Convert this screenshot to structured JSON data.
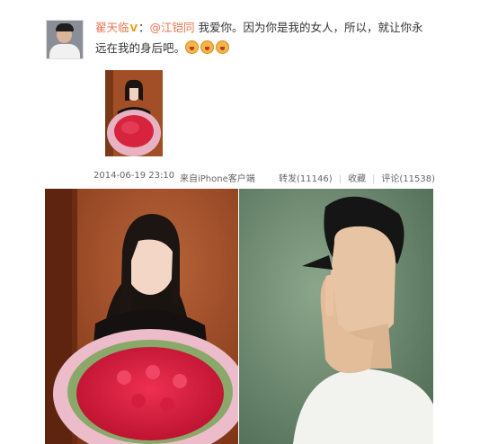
{
  "post": {
    "username": "翟天临",
    "verified_badge": "V",
    "separator": "：",
    "mention": "@江铠同",
    "text": " 我爱你。因为你是我的女人，所以，就让你永远在我的身后吧。",
    "emoji_count": 3
  },
  "meta": {
    "timestamp": "2014-06-19 23:10",
    "source": "来自iPhone客户端",
    "repost": "转发(11146)",
    "favorite": "收藏",
    "comment": "评论(11538)",
    "separator": "|"
  },
  "colors": {
    "link": "#eb7350",
    "badge": "#f29b12",
    "text": "#333333",
    "meta": "#666666"
  },
  "icons": [
    "avatar",
    "verified-v-badge-icon",
    "emoji-face-icon"
  ]
}
